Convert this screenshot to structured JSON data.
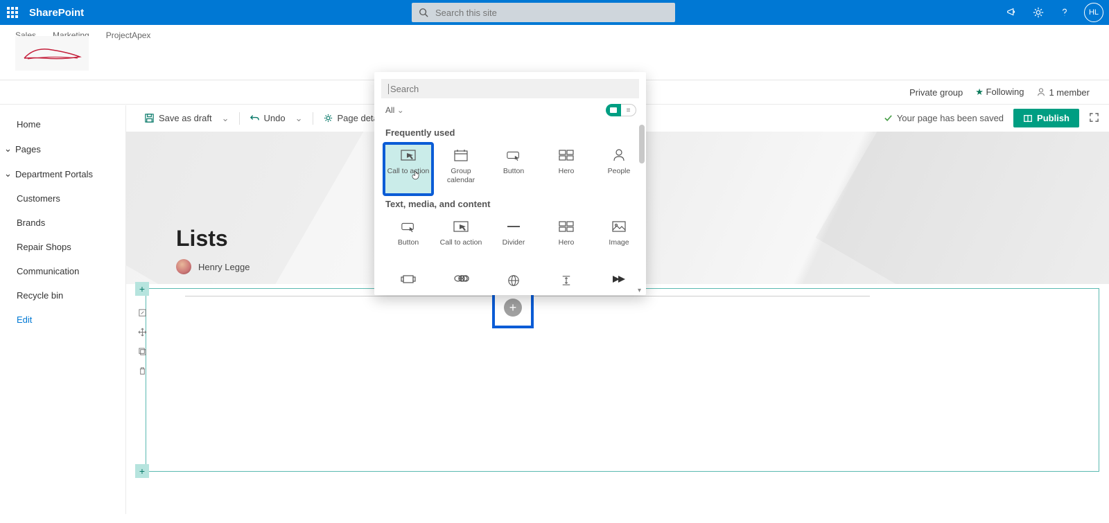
{
  "suite": {
    "app_name": "SharePoint",
    "search_placeholder": "Search this site",
    "avatar_initials": "HL"
  },
  "hub_links": [
    "Sales",
    "Marketing",
    "ProjectApex"
  ],
  "site_strip": {
    "group_type": "Private group",
    "following": "Following",
    "members": "1 member"
  },
  "cmd": {
    "save_draft": "Save as draft",
    "undo": "Undo",
    "page_details": "Page details",
    "saved_msg": "Your page has been saved",
    "publish": "Publish"
  },
  "left_nav": {
    "home": "Home",
    "pages": "Pages",
    "dept": "Department Portals",
    "customers": "Customers",
    "brands": "Brands",
    "repair": "Repair Shops",
    "comm": "Communication",
    "recycle": "Recycle bin",
    "edit": "Edit"
  },
  "page": {
    "title": "Lists",
    "author": "Henry Legge"
  },
  "picker": {
    "search_placeholder": "Search",
    "filter_label": "All",
    "section1_title": "Frequently used",
    "section2_title": "Text, media, and content",
    "freq": {
      "cta": "Call to action",
      "group_cal": "Group calendar",
      "button": "Button",
      "hero": "Hero",
      "people": "People"
    },
    "tmc": {
      "button": "Button",
      "cta": "Call to action",
      "divider": "Divider",
      "hero": "Hero",
      "image": "Image"
    }
  }
}
